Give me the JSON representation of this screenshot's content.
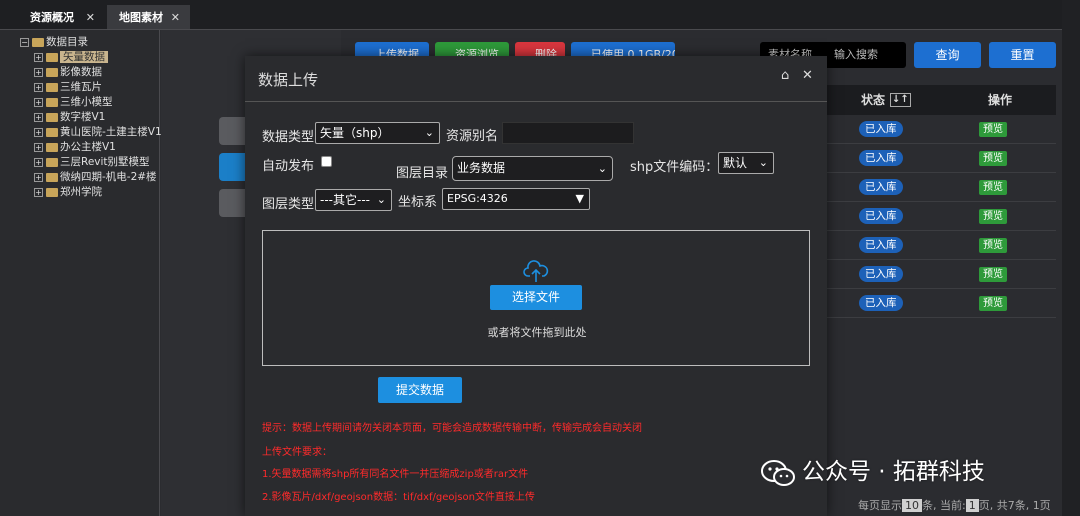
{
  "tabs": [
    {
      "label": "资源概况",
      "close": "✕"
    },
    {
      "label": "地图素材",
      "close": "✕"
    }
  ],
  "tree": {
    "root": "数据目录",
    "items": [
      "矢量数据",
      "影像数据",
      "三维瓦片",
      "三维小模型",
      "数字楼V1",
      "黄山医院-土建主楼V1",
      "办公主楼V1",
      "三层Revit别墅模型",
      "微纳四期-机电-2#楼",
      "郑州学院"
    ]
  },
  "toolbar": {
    "upload": "上传数据",
    "resource": "资源浏览",
    "delete": "删除",
    "used": "已使用 0.1GB/20G",
    "search_label": "素材名称",
    "search_placeholder": "输入搜索",
    "query": "查询",
    "reset": "重置"
  },
  "table": {
    "headers": {
      "status": "状态",
      "sort": "↓↑",
      "action": "操作"
    },
    "rows": [
      {
        "status": "已入库",
        "action": "预览"
      },
      {
        "status": "已入库",
        "action": "预览"
      },
      {
        "status": "已入库",
        "action": "预览"
      },
      {
        "status": "已入库",
        "action": "预览"
      },
      {
        "status": "已入库",
        "action": "预览"
      },
      {
        "status": "已入库",
        "action": "预览"
      },
      {
        "status": "已入库",
        "action": "预览"
      }
    ]
  },
  "pager": {
    "prefix": "每页显示",
    "page_size": "10",
    "mid": "条, 当前:",
    "current": "1",
    "suffix": "页, 共7条, 1页"
  },
  "modal": {
    "title": "数据上传",
    "pin_icon": "⌂",
    "close_icon": "✕",
    "data_type_label": "数据类型",
    "data_type_value": "矢量（shp）",
    "alias_label": "资源别名",
    "auto_publish_label": "自动发布",
    "layer_dir_label": "图层目录",
    "layer_dir_value": "业务数据",
    "encoding_label": "shp文件编码：",
    "encoding_value": "默认",
    "layer_type_label": "图层类型",
    "layer_type_value": "---其它---",
    "crs_label": "坐标系",
    "crs_value": "EPSG:4326",
    "choose_file": "选择文件",
    "drop_hint": "或者将文件拖到此处",
    "submit": "提交数据",
    "tips": [
      "提示：数据上传期间请勿关闭本页面，可能会造成数据传输中断，传输完成会自动关闭",
      "上传文件要求：",
      "1.矢量数据需将shp所有同名文件一并压缩成zip或者rar文件",
      "2.影像瓦片/dxf/geojson数据：tif/dxf/geojson文件直接上传"
    ]
  },
  "watermark": "公众号 · 拓群科技",
  "colors": {
    "accent": "#1d8fe0",
    "danger": "#ff2b2b",
    "badge": "#1d61b8",
    "preview": "#2e9a3a"
  }
}
